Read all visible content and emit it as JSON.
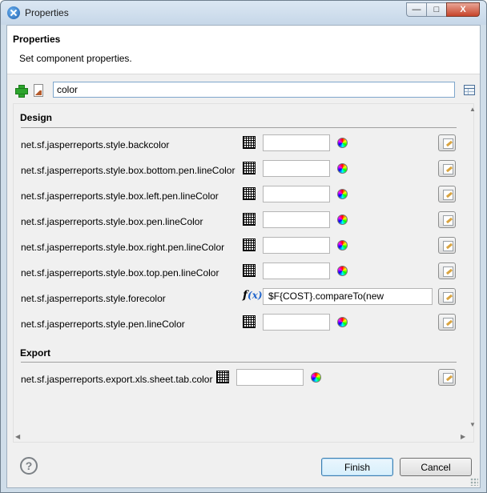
{
  "window": {
    "title": "Properties",
    "minimize": "—",
    "maximize": "□",
    "close": "X"
  },
  "header": {
    "title": "Properties",
    "description": "Set component properties."
  },
  "toolbar": {
    "filter_value": "color"
  },
  "sections": {
    "design": {
      "title": "Design",
      "rows": [
        {
          "label": "net.sf.jasperreports.style.backcolor",
          "type": "color",
          "value": ""
        },
        {
          "label": "net.sf.jasperreports.style.box.bottom.pen.lineColor",
          "type": "color",
          "value": ""
        },
        {
          "label": "net.sf.jasperreports.style.box.left.pen.lineColor",
          "type": "color",
          "value": ""
        },
        {
          "label": "net.sf.jasperreports.style.box.pen.lineColor",
          "type": "color",
          "value": ""
        },
        {
          "label": "net.sf.jasperreports.style.box.right.pen.lineColor",
          "type": "color",
          "value": ""
        },
        {
          "label": "net.sf.jasperreports.style.box.top.pen.lineColor",
          "type": "color",
          "value": ""
        },
        {
          "label": "net.sf.jasperreports.style.forecolor",
          "type": "expression",
          "value": "$F{COST}.compareTo(new"
        },
        {
          "label": "net.sf.jasperreports.style.pen.lineColor",
          "type": "color",
          "value": ""
        }
      ]
    },
    "export": {
      "title": "Export",
      "rows": [
        {
          "label": "net.sf.jasperreports.export.xls.sheet.tab.color",
          "type": "color",
          "value": ""
        }
      ]
    }
  },
  "footer": {
    "help": "?",
    "finish_label": "Finish",
    "cancel_label": "Cancel"
  }
}
